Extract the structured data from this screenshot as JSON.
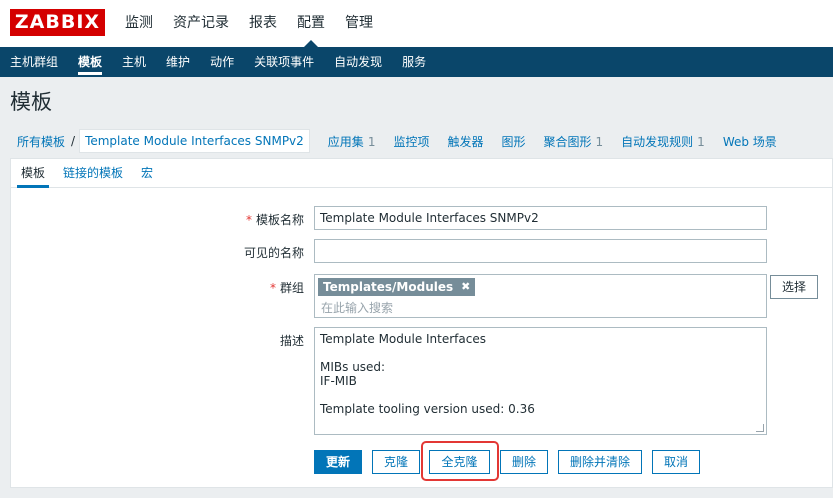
{
  "app": {
    "logo": "ZABBIX",
    "main_menu": [
      "监测",
      "资产记录",
      "报表",
      "配置",
      "管理"
    ],
    "main_menu_active_index": 3,
    "sub_menu": [
      "主机群组",
      "模板",
      "主机",
      "维护",
      "动作",
      "关联项事件",
      "自动发现",
      "服务"
    ],
    "sub_menu_active_index": 1
  },
  "page": {
    "title": "模板",
    "breadcrumb_root": "所有模板",
    "breadcrumb_separator": "/",
    "breadcrumb_current": "Template Module Interfaces SNMPv2",
    "tabs": [
      {
        "label": "应用集",
        "count": "1"
      },
      {
        "label": "监控项",
        "count": ""
      },
      {
        "label": "触发器",
        "count": ""
      },
      {
        "label": "图形",
        "count": ""
      },
      {
        "label": "聚合图形",
        "count": "1"
      },
      {
        "label": "自动发现规则",
        "count": "1"
      },
      {
        "label": "Web 场景",
        "count": ""
      }
    ]
  },
  "form": {
    "tabs": [
      "模板",
      "链接的模板",
      "宏"
    ],
    "active_tab_index": 0,
    "fields": {
      "template_name": {
        "label": "模板名称",
        "required": "*",
        "value": "Template Module Interfaces SNMPv2"
      },
      "visible_name": {
        "label": "可见的名称",
        "value": ""
      },
      "groups": {
        "label": "群组",
        "required": "*",
        "chip": "Templates/Modules",
        "chip_remove": "✖",
        "placeholder": "在此输入搜索",
        "select_button": "选择"
      },
      "description": {
        "label": "描述",
        "value": "Template Module Interfaces\n\nMIBs used:\nIF-MIB\n\nTemplate tooling version used: 0.36"
      }
    },
    "buttons": {
      "update": "更新",
      "clone": "克隆",
      "full_clone": "全克隆",
      "delete": "删除",
      "delete_clear": "删除并清除",
      "cancel": "取消"
    }
  },
  "colors": {
    "brand": "#d40000",
    "nav": "#0a466a",
    "link": "#0275b8",
    "highlight": "#e33734"
  }
}
